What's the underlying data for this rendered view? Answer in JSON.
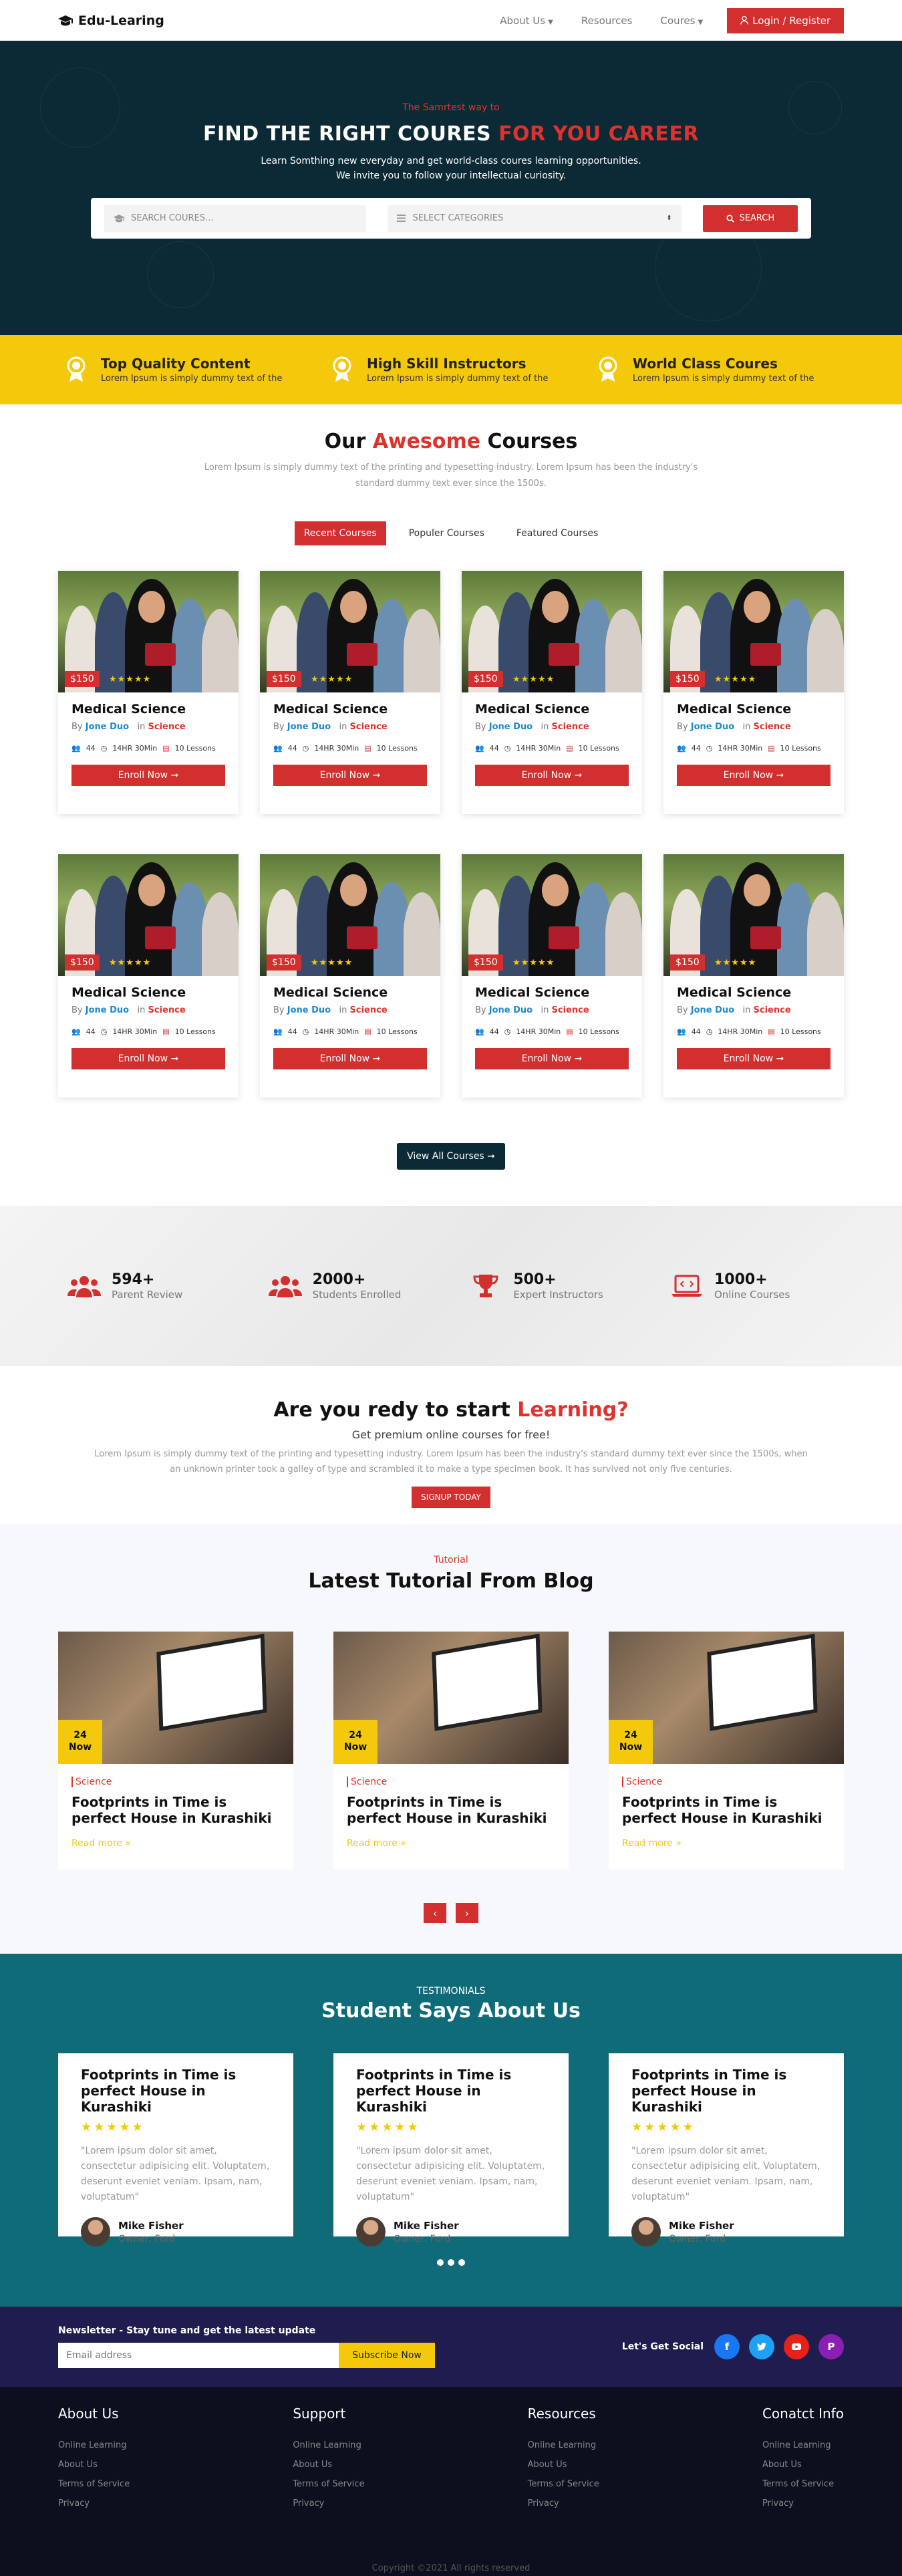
{
  "nav": {
    "brand": "Edu-Learing",
    "links": [
      "About Us",
      "Resources",
      "Coures"
    ],
    "login": "Login / Register"
  },
  "hero": {
    "kicker": "The Samrtest way to",
    "title_main": "FIND THE RIGHT COURES",
    "title_accent": "FOR YOU CAREER",
    "line1": "Learn Somthing new everyday and get world-class coures learning opportunities.",
    "line2": "We invite you to follow your intellectual curiosity.",
    "search_placeholder": "SEARCH COURES...",
    "category_placeholder": "SELECT CATEGORIES",
    "search_button": "SEARCH"
  },
  "features": [
    {
      "title": "Top Quality Content",
      "text": "Lorem Ipsum is simply dummy text of the",
      "icon": "award-icon"
    },
    {
      "title": "High Skill Instructors",
      "text": "Lorem Ipsum is simply dummy text of the",
      "icon": "award-icon"
    },
    {
      "title": "World Class Coures",
      "text": "Lorem Ipsum is simply dummy text of the",
      "icon": "award-icon"
    }
  ],
  "courses": {
    "title_pre": "Our",
    "title_accent": "Awesome",
    "title_post": "Courses",
    "subtitle": "Lorem Ipsum is simply dummy text of the printing and typesetting industry. Lorem Ipsum has been the industry's standard dummy text ever since the 1500s.",
    "tabs": [
      "Recent Courses",
      "Populer Courses",
      "Featured Courses"
    ],
    "card": {
      "price": "$150",
      "stars": "★★★★★",
      "title": "Medical Science",
      "by": "By",
      "author": "Jone Duo",
      "in": "in",
      "category": "Science",
      "students": "44",
      "duration": "14HR 30Min",
      "lessons": "10 Lessons",
      "enroll": "Enroll Now ➞"
    },
    "view_all": "View All Courses ➞"
  },
  "counters": [
    {
      "value": "594+",
      "label": "Parent Review",
      "icon": "users-icon"
    },
    {
      "value": "2000+",
      "label": "Students Enrolled",
      "icon": "users-icon"
    },
    {
      "value": "500+",
      "label": "Expert Instructors",
      "icon": "trophy-icon"
    },
    {
      "value": "1000+",
      "label": "Online Courses",
      "icon": "laptop-icon"
    }
  ],
  "cta": {
    "title_pre": "Are you redy to start",
    "title_accent": "Learning?",
    "sub": "Get premium online courses for free!",
    "text1": "Lorem Ipsum is simply dummy text of the printing and typesetting industry. Lorem Ipsum has been the industry's standard dummy text ever since the 1500s, when",
    "text2": "an unknown printer took a galley of type and scrambled it to make a type specimen book. It has survived not only five centuries.",
    "button": "SIGNUP TODAY"
  },
  "blog": {
    "kicker": "Tutorial",
    "title": "Latest Tutorial From Blog",
    "post": {
      "day": "24",
      "month": "Now",
      "category": "Science",
      "title": "Footprints in Time is perfect House in Kurashiki",
      "read_more": "Read more »"
    },
    "prev": "‹",
    "next": "›"
  },
  "testimonials": {
    "kicker": "TESTIMONIALS",
    "title": "Student Says About Us",
    "item": {
      "title": "Footprints in Time is perfect House in Kurashiki",
      "stars": "★★★★★",
      "quote": "\"Lorem ipsum dolor sit amet, consectetur adipisicing elit. Voluptatem, deserunt eveniet veniam. Ipsam, nam, voluptatum\"",
      "name": "Mike Fisher",
      "role": "Owner, Ford"
    }
  },
  "newsletter": {
    "title": "Newsletter - Stay tune and get the latest update",
    "placeholder": "Email address",
    "button": "Subscribe Now",
    "social_label": "Let's Get Social",
    "social_colors": {
      "facebook": "#1877f2",
      "twitter": "#1da1f2",
      "youtube": "#e62117",
      "pinterest": "#8b1fb4"
    }
  },
  "footer": {
    "columns": [
      {
        "title": "About Us",
        "links": [
          "Online Learning",
          "About Us",
          "Terms of Service",
          "Privacy"
        ]
      },
      {
        "title": "Support",
        "links": [
          "Online Learning",
          "About Us",
          "Terms of Service",
          "Privacy"
        ]
      },
      {
        "title": "Resources",
        "links": [
          "Online Learning",
          "About Us",
          "Terms of Service",
          "Privacy"
        ]
      },
      {
        "title": "Conatct Info",
        "links": [
          "Online Learning",
          "About Us",
          "Terms of Service",
          "Privacy"
        ]
      }
    ],
    "copyright": "Copyright ©2021 All rights reserved"
  },
  "colors": {
    "accent": "#d32f2f",
    "dark": "#0c2a35",
    "yellow": "#f4c90b",
    "teal": "#0f6b78",
    "navy": "#1f1d4f"
  }
}
